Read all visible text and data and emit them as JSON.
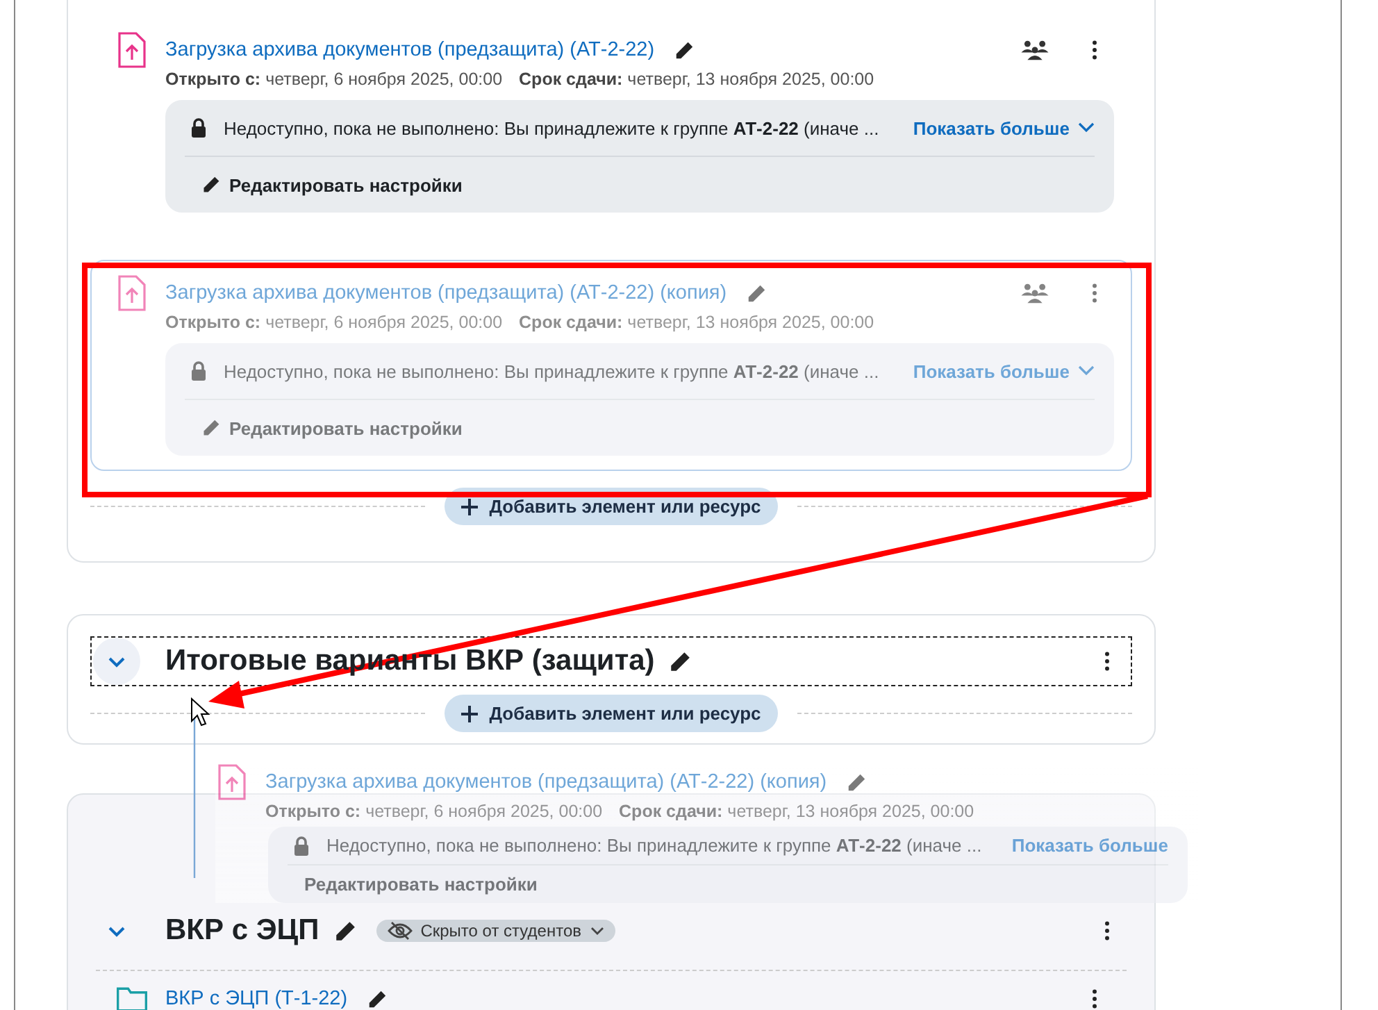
{
  "sections": [
    {
      "kind": "cut",
      "drop_target": false,
      "activities": [
        {
          "kind": "assign",
          "title": "Загрузка архива документов (предзащита) (АТ-2-22)",
          "dimmed": false,
          "highlighted": false,
          "open_label": "Открыто с:",
          "open_value": "четверг, 6 ноября 2025, 00:00",
          "due_label": "Срок сдачи:",
          "due_value": "четверг, 13 ноября 2025, 00:00",
          "restriction": "Недоступно, пока не выполнено: Вы принадлежите к группе **АТ-2-22** (иначе ...",
          "show_more": "Показать больше",
          "edit_settings": "Редактировать настройки"
        },
        {
          "kind": "assign",
          "title": "Загрузка архива документов (предзащита) (АТ-2-22) (копия)",
          "dimmed": true,
          "highlighted": true,
          "open_label": "Открыто с:",
          "open_value": "четверг, 6 ноября 2025, 00:00",
          "due_label": "Срок сдачи:",
          "due_value": "четверг, 13 ноября 2025, 00:00",
          "restriction": "Недоступно, пока не выполнено: Вы принадлежите к группе **АТ-2-22** (иначе ...",
          "show_more": "Показать больше",
          "edit_settings": "Редактировать настройки"
        }
      ],
      "add_label": "Добавить элемент или ресурс"
    },
    {
      "kind": "section",
      "title": "Итоговые варианты ВКР (защита)",
      "expanded": true,
      "drop_target": true,
      "add_label": "Добавить элемент или ресурс"
    },
    {
      "kind": "section",
      "title": "ВКР с ЭЦП",
      "expanded": true,
      "drop_target": false,
      "hidden_badge": "Скрыто от студентов",
      "activities": [
        {
          "kind": "folder",
          "title": "ВКР с ЭЦП (Т-1-22)",
          "dimmed": false,
          "highlighted": false
        }
      ]
    }
  ],
  "drag_ghost": {
    "kind": "assign",
    "title": "Загрузка архива документов (предзащита) (АТ-2-22) (копия)",
    "open_label": "Открыто с:",
    "open_value": "четверг, 6 ноября 2025, 00:00",
    "due_label": "Срок сдачи:",
    "due_value": "четверг, 13 ноября 2025, 00:00",
    "restriction": "Недоступно, пока не выполнено: Вы принадлежите к группе **АТ-2-22** (иначе ...",
    "show_more": "Показать больше",
    "edit_settings": "Редактировать настройки"
  }
}
